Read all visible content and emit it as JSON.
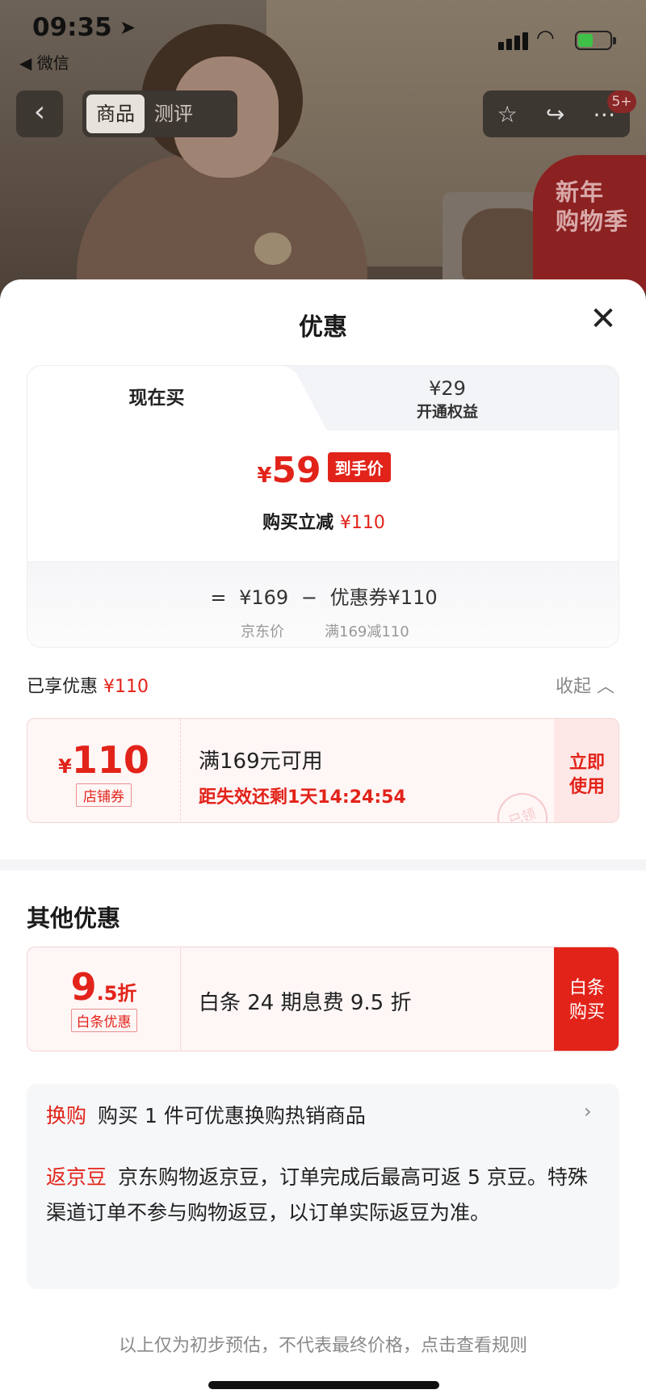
{
  "status_bar": {
    "time": "09:35",
    "back_app": "◀ 微信"
  },
  "nav": {
    "tabs": [
      {
        "label": "商品"
      },
      {
        "label": "测评"
      }
    ],
    "badge": "5+",
    "promo_line1": "新年",
    "promo_line2": "购物季"
  },
  "sheet": {
    "title": "优惠",
    "price_tabs": {
      "now": "现在买",
      "member_price": "¥29",
      "member_label": "开通权益"
    },
    "final_price": {
      "currency": "¥",
      "value": "59",
      "tag": "到手价"
    },
    "reduce": {
      "label": "购买立减",
      "value": "¥110"
    },
    "formula": {
      "eq": "=",
      "jd_price": "¥169",
      "minus": "−",
      "coupon": "优惠券¥110",
      "jd_label": "京东价",
      "coupon_label": "满169减110"
    },
    "enjoyed": {
      "label": "已享优惠",
      "value": "¥110",
      "collapse": "收起 ︿"
    },
    "coupon": {
      "currency": "¥",
      "amount": "110",
      "kind": "店铺券",
      "condition": "满169元可用",
      "timer": "距失效还剩1天14:24:54",
      "use_line1": "立即",
      "use_line2": "使用",
      "stamp": "已领"
    },
    "other": {
      "title": "其他优惠",
      "baitiao": {
        "disc_big": "9",
        "disc_small": ".5折",
        "kind": "白条优惠",
        "desc": "白条 24 期息费 9.5 折",
        "btn_line1": "白条",
        "btn_line2": "购买"
      },
      "swap": {
        "label": "换购",
        "text": "购买 1 件可优惠换购热销商品"
      },
      "beans": {
        "label": "返京豆",
        "text": "京东购物返京豆，订单完成后最高可返 5 京豆。特殊渠道订单不参与购物返豆，以订单实际返豆为准。"
      }
    },
    "footnote": "以上仅为初步预估，不代表最终价格，点击查看规则"
  },
  "colors": {
    "accent": "#e2231a",
    "coupon_bg": "#fff6f6"
  },
  "icons": {
    "back": "chevron-left-icon",
    "star": "star-icon",
    "share": "share-icon",
    "more": "more-icon",
    "close": "close-icon"
  }
}
